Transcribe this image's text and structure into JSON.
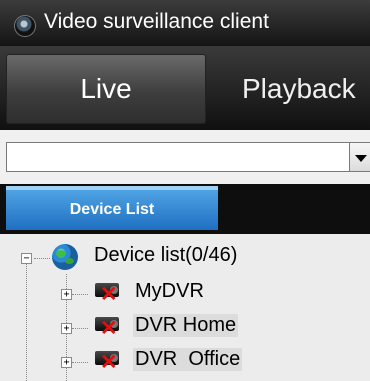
{
  "window": {
    "title": "Video surveillance client",
    "icon": "camera-app-icon"
  },
  "tabs": [
    {
      "label": "Live",
      "active": true
    },
    {
      "label": "Playback",
      "active": false
    }
  ],
  "combo": {
    "value": "",
    "icon": "chevron-down-icon"
  },
  "list_tabs": {
    "active_label": "Device List"
  },
  "tree": {
    "root": {
      "label": "Device list(0/46)",
      "expander": "−",
      "icon": "globe-icon"
    },
    "children": [
      {
        "label": "MyDVR",
        "expander": "+",
        "icon": "dvr-offline-icon",
        "selected": false
      },
      {
        "label": "DVR Home",
        "expander": "+",
        "icon": "dvr-offline-icon",
        "selected": true
      },
      {
        "label": "DVR  Office",
        "expander": "+",
        "icon": "dvr-offline-icon",
        "selected": true
      }
    ]
  },
  "colors": {
    "device_tab": "#2e86d8",
    "offline_x": "#e01010"
  }
}
